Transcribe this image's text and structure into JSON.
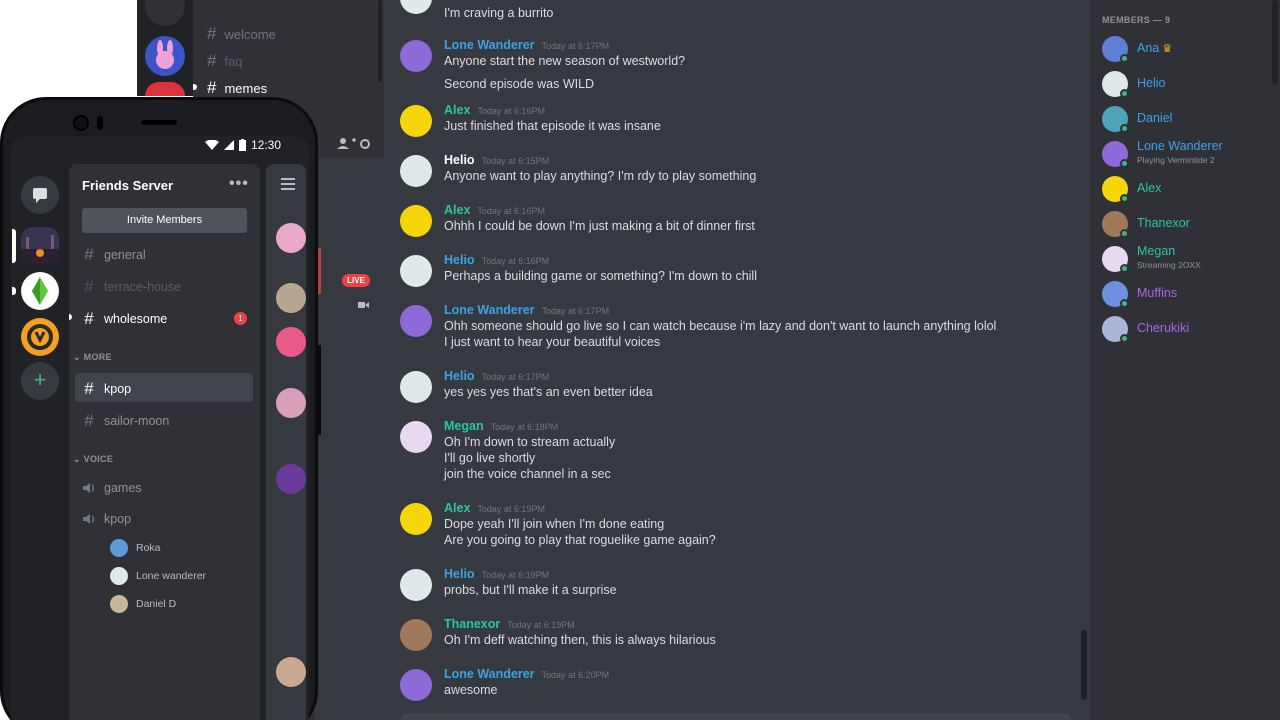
{
  "desktop": {
    "channels": [
      {
        "name": "welcome",
        "active": false
      },
      {
        "name": "faq",
        "active": false
      },
      {
        "name": "memes",
        "active": true
      }
    ],
    "live_badge": "LIVE"
  },
  "chat": {
    "messages": [
      {
        "author": "",
        "timestamp": "",
        "lines": [
          "I'm craving a burrito"
        ]
      },
      {
        "author": "Lone Wanderer",
        "timestamp": "Today at 6:17PM",
        "color": "#3ba2e6",
        "avatar": "#8e6ad8",
        "lines": [
          "Anyone start the new season of westworld?",
          "Second episode was WILD"
        ]
      },
      {
        "author": "Alex",
        "timestamp": "Today at 6:16PM",
        "color": "#2bc6a0",
        "avatar": "#f5d60a",
        "lines": [
          "Just finished that episode it was insane"
        ]
      },
      {
        "author": "Helio",
        "timestamp": "Today at 6:15PM",
        "color": "#ffffff",
        "avatar": "#dfe9ea",
        "lines": [
          "Anyone want to play anything? I'm rdy to play something"
        ]
      },
      {
        "author": "Alex",
        "timestamp": "Today at 6:16PM",
        "color": "#2bc6a0",
        "avatar": "#f5d60a",
        "lines": [
          "Ohhh I could be down I'm just making a bit of dinner first"
        ]
      },
      {
        "author": "Helio",
        "timestamp": "Today at 6:16PM",
        "color": "#3ba2e6",
        "avatar": "#dfe9ea",
        "lines": [
          "Perhaps a building game or something? I'm down to chill"
        ]
      },
      {
        "author": "Lone Wanderer",
        "timestamp": "Today at 6:17PM",
        "color": "#3ba2e6",
        "avatar": "#8e6ad8",
        "lines": [
          "Ohh someone should go live so I can watch because i'm lazy and don't want to launch anything lolol",
          "I just want to hear your beautiful voices"
        ]
      },
      {
        "author": "Helio",
        "timestamp": "Today at 6:17PM",
        "color": "#3ba2e6",
        "avatar": "#dfe9ea",
        "lines": [
          "yes yes yes that's an even better idea"
        ]
      },
      {
        "author": "Megan",
        "timestamp": "Today at 6:18PM",
        "color": "#2bc6a0",
        "avatar": "#e8d8f0",
        "lines": [
          "Oh I'm down to stream actually",
          "I'll go live shortly",
          "join the voice channel in a sec"
        ]
      },
      {
        "author": "Alex",
        "timestamp": "Today at 6:19PM",
        "color": "#2bc6a0",
        "avatar": "#f5d60a",
        "lines": [
          "Dope yeah I'll join when I'm done eating",
          "Are you going to play that roguelike game again?"
        ]
      },
      {
        "author": "Helio",
        "timestamp": "Today at 6:19PM",
        "color": "#3ba2e6",
        "avatar": "#dfe9ea",
        "lines": [
          "probs, but I'll make it a surprise"
        ]
      },
      {
        "author": "Thanexor",
        "timestamp": "Today at 6:19PM",
        "color": "#2bc6a0",
        "avatar": "#a0795a",
        "lines": [
          "Oh I'm deff watching then, this is always hilarious"
        ]
      },
      {
        "author": "Lone Wanderer",
        "timestamp": "Today at 6:20PM",
        "color": "#3ba2e6",
        "avatar": "#8e6ad8",
        "lines": [
          "awesome"
        ]
      }
    ]
  },
  "members": {
    "header": "MEMBERS — 9",
    "list": [
      {
        "name": "Ana",
        "color": "#3ba2e6",
        "avatar": "#5f7fd6",
        "activity": "",
        "crown": true
      },
      {
        "name": "Helio",
        "color": "#3ba2e6",
        "avatar": "#dfe9ea",
        "activity": ""
      },
      {
        "name": "Daniel",
        "color": "#3ba2e6",
        "avatar": "#4fa3b8",
        "activity": ""
      },
      {
        "name": "Lone Wanderer",
        "color": "#3ba2e6",
        "avatar": "#8e6ad8",
        "activity": "Playing Vermintide 2"
      },
      {
        "name": "Alex",
        "color": "#2bc6a0",
        "avatar": "#f5d60a",
        "activity": ""
      },
      {
        "name": "Thanexor",
        "color": "#2bc6a0",
        "avatar": "#a0795a",
        "activity": ""
      },
      {
        "name": "Megan",
        "color": "#2bc6a0",
        "avatar": "#e8d8f0",
        "activity": "Streaming 2OXX"
      },
      {
        "name": "Muffins",
        "color": "#a868e0",
        "avatar": "#6d8fe0",
        "activity": ""
      },
      {
        "name": "Cherukiki",
        "color": "#a868e0",
        "avatar": "#aab6d8",
        "activity": ""
      }
    ]
  },
  "phone": {
    "time": "12:30",
    "server_name": "Friends Server",
    "menu_glyph": "•••",
    "invite_label": "Invite Members",
    "text_channels": [
      {
        "name": "general",
        "style": "normal"
      },
      {
        "name": "terrace-house",
        "style": "muted"
      },
      {
        "name": "wholesome",
        "style": "white",
        "unread": "1"
      }
    ],
    "more_label": "MORE",
    "more_channels": [
      {
        "name": "kpop",
        "style": "white"
      },
      {
        "name": "sailor-moon",
        "style": "normal"
      }
    ],
    "voice_label": "VOICE",
    "voice_channels": [
      "games",
      "kpop"
    ],
    "voice_users": [
      {
        "name": "Roka",
        "avatar": "#5a9bd8"
      },
      {
        "name": "Lone wanderer",
        "avatar": "#dfe9ea"
      },
      {
        "name": "Daniel D",
        "avatar": "#c9b79a"
      }
    ],
    "add_server_glyph": "+"
  }
}
